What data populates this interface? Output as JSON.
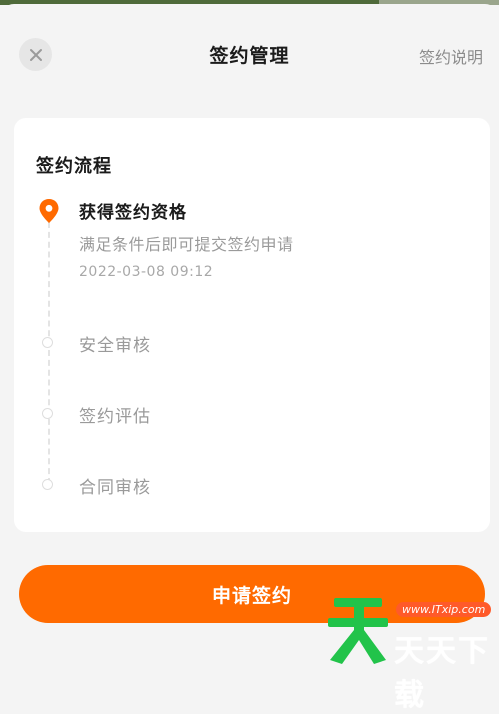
{
  "header": {
    "title": "签约管理",
    "help_link": "签约说明"
  },
  "card": {
    "title": "签约流程",
    "steps": [
      {
        "title": "获得签约资格",
        "desc": "满足条件后即可提交签约申请",
        "time": "2022-03-08 09:12",
        "status": "active"
      },
      {
        "title": "安全审核",
        "status": "pending"
      },
      {
        "title": "签约评估",
        "status": "pending"
      },
      {
        "title": "合同审核",
        "status": "pending"
      }
    ]
  },
  "apply_button": "申请签约",
  "watermark": {
    "url": "www.ITxip.com",
    "brand": "天天下载",
    "logo_char": "天"
  },
  "colors": {
    "accent": "#ff6a00",
    "pin": "#ff6a00",
    "watermark_green": "#22c34a"
  },
  "icons": {
    "close": "close-icon",
    "active_step": "location-pin-icon",
    "pending_step": "circle-dot-icon"
  }
}
